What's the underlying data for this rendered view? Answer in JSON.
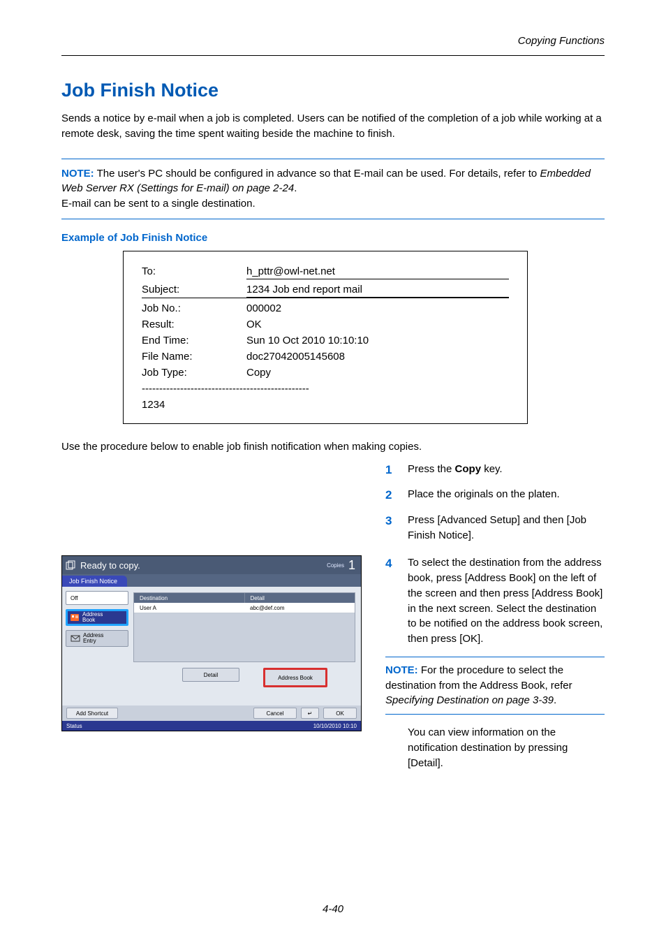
{
  "header": {
    "section": "Copying Functions"
  },
  "title": "Job Finish Notice",
  "intro": "Sends a notice by e-mail when a job is completed. Users can be notified of the completion of a job while working at a remote desk, saving the time spent waiting beside the machine to finish.",
  "note1": {
    "label": "NOTE:",
    "line1a": " The user's PC should be configured in advance so that E-mail can be used. For details, refer to ",
    "line1b": "Embedded Web Server RX (Settings for E-mail) on page 2-24",
    "line1c": ".",
    "line2": "E-mail can be sent to a single destination."
  },
  "example": {
    "heading": "Example of Job Finish Notice",
    "to_label": "To:",
    "to_value": "h_pttr@owl-net.net",
    "subject_label": "Subject:",
    "subject_value": "1234 Job end report mail",
    "jobno_label": "Job No.:",
    "jobno_value": "000002",
    "result_label": "Result:",
    "result_value": "OK",
    "end_label": "End Time:",
    "end_value": "Sun 10 Oct 2010 10:10:10",
    "file_label": "File Name:",
    "file_value": "doc27042005145608",
    "type_label": "Job Type:",
    "type_value": "Copy",
    "dashes": "------------------------------------------------",
    "trailing": "1234"
  },
  "lead": "Use the procedure below to enable job finish notification when making copies.",
  "steps": {
    "s1n": "1",
    "s1_a": "Press the ",
    "s1_b": "Copy",
    "s1_c": " key.",
    "s2n": "2",
    "s2": "Place the originals on the platen.",
    "s3n": "3",
    "s3": "Press [Advanced Setup] and then [Job Finish Notice].",
    "s4n": "4",
    "s4": "To select the destination from the address book, press [Address Book] on the left of the screen and then press [Address Book] in the next screen. Select the destination to be notified on the address book screen, then press [OK]."
  },
  "note2": {
    "label": "NOTE:",
    "text_a": " For the procedure to select the destination from the Address Book, refer ",
    "text_b": "Specifying Destination on page 3-39",
    "text_c": "."
  },
  "after": "You can view information on the notification destination by pressing [Detail].",
  "panel": {
    "title": "Ready to copy.",
    "copies_label": "Copies",
    "copies_num": "1",
    "tab": "Job Finish Notice",
    "off": "Off",
    "addr_book": "Address\nBook",
    "addr_entry": "Address\nEntry",
    "col1": "Destination",
    "col2": "Detail",
    "row_user": "User A",
    "row_detail": "abc@def.com",
    "btn_detail": "Detail",
    "btn_ab": "Address Book",
    "ft_shortcut": "Add Shortcut",
    "ft_cancel": "Cancel",
    "ft_back": "↵",
    "ft_ok": "OK",
    "status": "Status",
    "time": "10/10/2010  10:10"
  },
  "pagenum": "4-40"
}
